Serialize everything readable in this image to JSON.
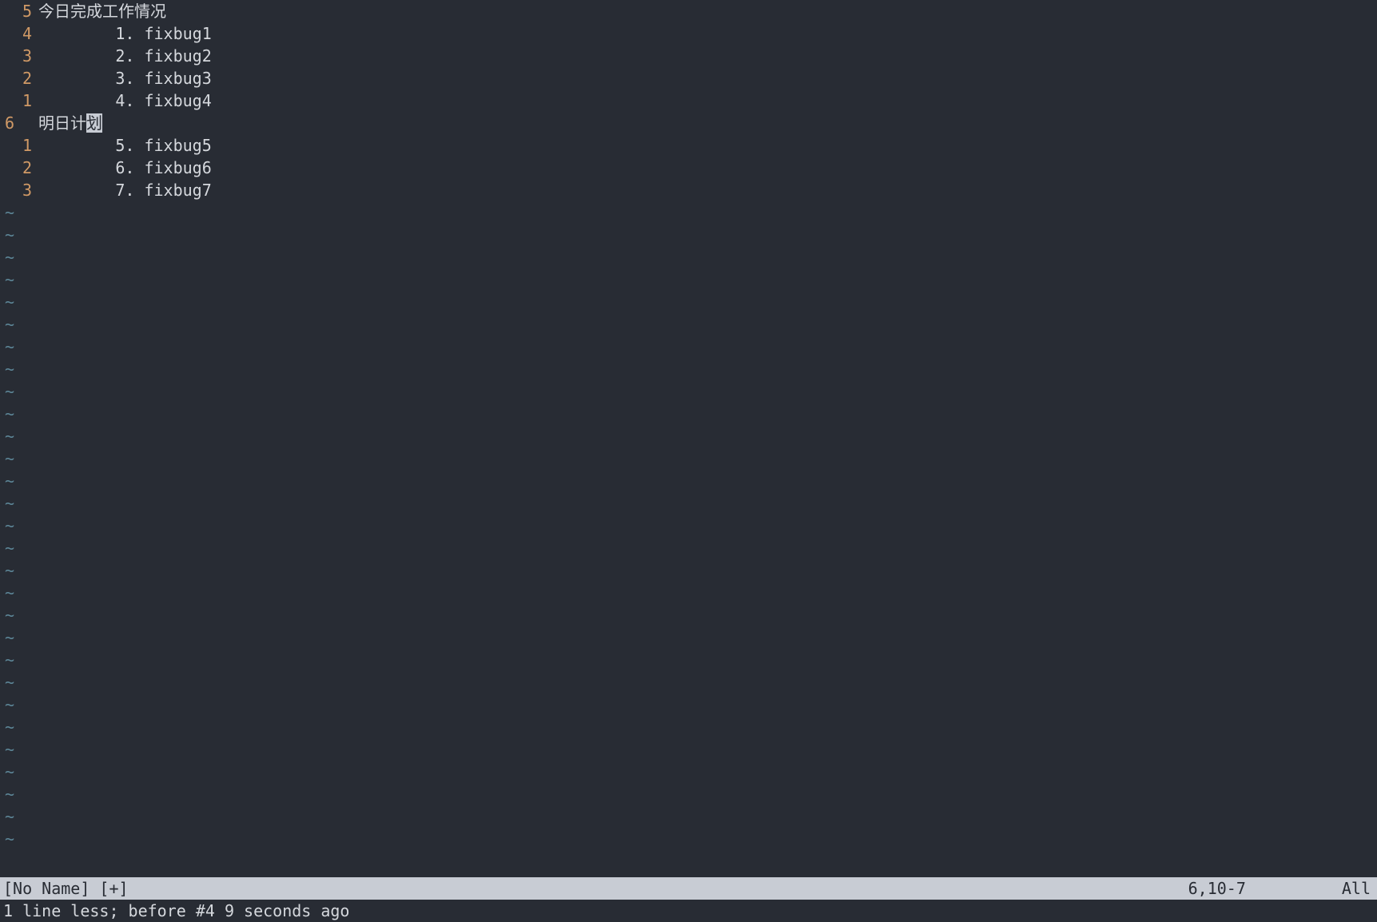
{
  "lines": [
    {
      "gutter": "5",
      "gutterClass": "relative",
      "text": "今日完成工作情况",
      "hasCursor": false
    },
    {
      "gutter": "4",
      "gutterClass": "relative",
      "text": "        1. fixbug1",
      "hasCursor": false
    },
    {
      "gutter": "3",
      "gutterClass": "relative",
      "text": "        2. fixbug2",
      "hasCursor": false
    },
    {
      "gutter": "2",
      "gutterClass": "relative",
      "text": "        3. fixbug3",
      "hasCursor": false
    },
    {
      "gutter": "1",
      "gutterClass": "relative",
      "text": "        4. fixbug4",
      "hasCursor": false
    },
    {
      "gutter": "6 ",
      "gutterClass": "current",
      "textBefore": "明日计",
      "cursorChar": "划",
      "textAfter": "",
      "hasCursor": true
    },
    {
      "gutter": "1",
      "gutterClass": "relative",
      "text": "        5. fixbug5",
      "hasCursor": false
    },
    {
      "gutter": "2",
      "gutterClass": "relative",
      "text": "        6. fixbug6",
      "hasCursor": false
    },
    {
      "gutter": "3",
      "gutterClass": "relative",
      "text": "        7. fixbug7",
      "hasCursor": false
    }
  ],
  "tildeChar": "~",
  "tildeCount": 29,
  "statusBar": {
    "filename": "[No Name] [+]",
    "ruler": "6,10-7",
    "position": "All"
  },
  "message": "1 line less; before #4  9 seconds ago"
}
